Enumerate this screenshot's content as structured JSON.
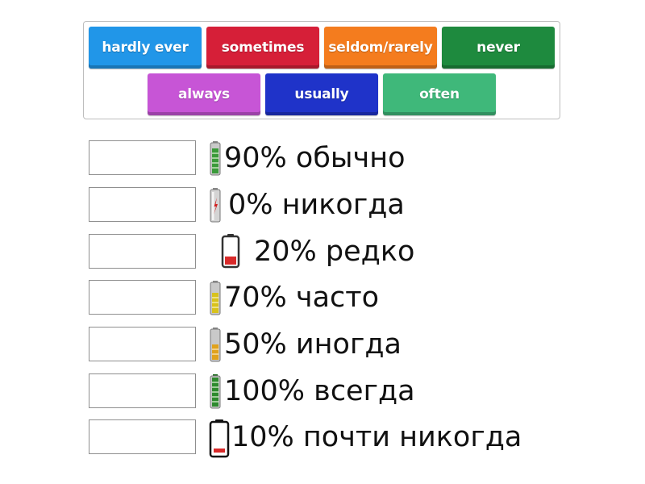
{
  "word_bank": [
    {
      "label": "hardly ever",
      "color": "#2196e8"
    },
    {
      "label": "sometimes",
      "color": "#d61f38"
    },
    {
      "label": "seldom/rarely",
      "color": "#f47c1e"
    },
    {
      "label": "never",
      "color": "#1e8a3e"
    },
    {
      "label": "always",
      "color": "#c755d6"
    },
    {
      "label": "usually",
      "color": "#1f33c9"
    },
    {
      "label": "often",
      "color": "#3fb87a"
    }
  ],
  "rows": [
    {
      "text": "90% обычно",
      "battery_icon": "battery-90-icon",
      "level": 0.9
    },
    {
      "text": "0% никогда",
      "battery_icon": "battery-empty-icon",
      "level": 0.0
    },
    {
      "text": "20% редко",
      "battery_icon": "battery-low-icon",
      "level": 0.2
    },
    {
      "text": "70% часто",
      "battery_icon": "battery-70-icon",
      "level": 0.7
    },
    {
      "text": "50% иногда",
      "battery_icon": "battery-50-icon",
      "level": 0.5
    },
    {
      "text": "100% всегда",
      "battery_icon": "battery-full-icon",
      "level": 1.0
    },
    {
      "text": "10% почти никогда",
      "battery_icon": "battery-10-icon",
      "level": 0.1
    }
  ]
}
